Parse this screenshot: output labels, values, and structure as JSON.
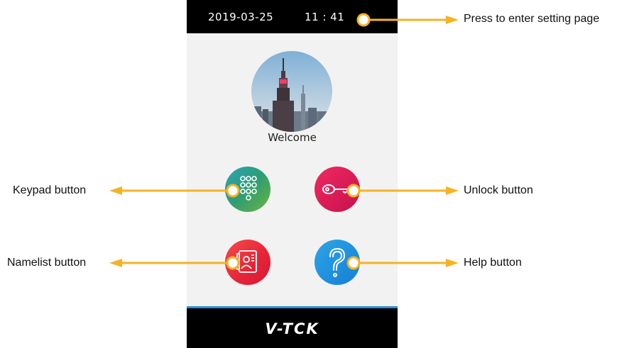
{
  "status_bar": {
    "date": "2019-03-25",
    "time": "11 : 41"
  },
  "welcome_text": "Welcome",
  "brand": "V-TCK",
  "buttons": {
    "keypad": {
      "icon": "keypad-icon",
      "color": "#2f9d74"
    },
    "unlock": {
      "icon": "key-icon",
      "color": "#d81a55"
    },
    "namelist": {
      "icon": "contact-card-icon",
      "color": "#e52437"
    },
    "help": {
      "icon": "question-mark-icon",
      "color": "#1e8ede"
    }
  },
  "annotations": {
    "settings": "Press to enter setting page",
    "keypad": "Keypad button",
    "unlock": "Unlock button",
    "namelist": "Namelist button",
    "help": "Help button"
  },
  "colors": {
    "arrow": "#f5b324",
    "accent_line": "#2e8fd8"
  }
}
